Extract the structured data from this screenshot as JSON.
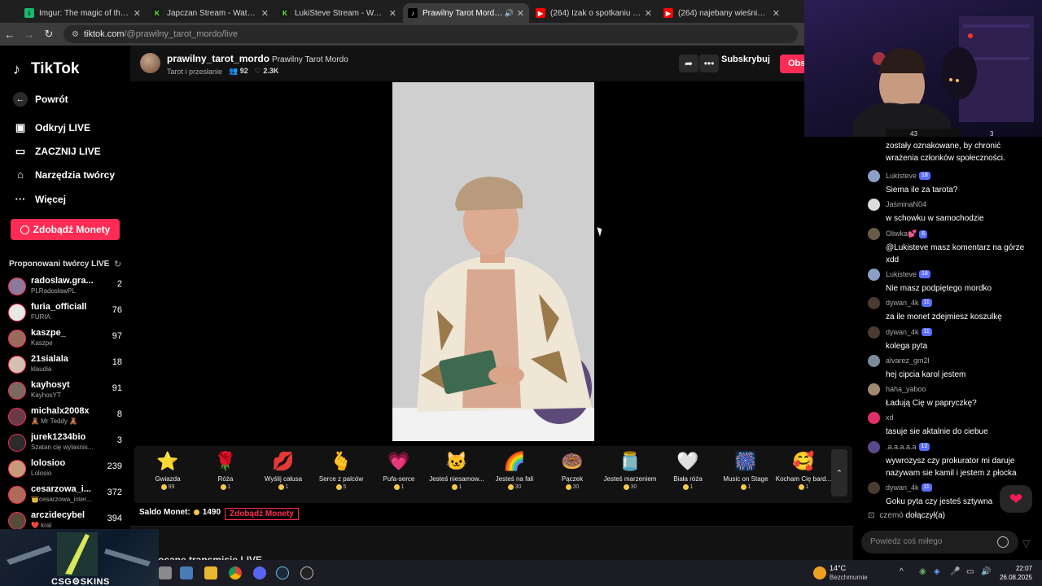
{
  "browser": {
    "tabs": [
      {
        "title": "Imgur: The magic of the Internet",
        "icon": "imgur-icon",
        "active": false
      },
      {
        "title": "Japczan Stream - Watch Live on Kick",
        "icon": "kick-icon",
        "active": false
      },
      {
        "title": "LukiSteve Stream - Watch Live on Kick",
        "icon": "kick-icon",
        "active": false
      },
      {
        "title": "Prawilny Tarot Mordo (@prawilny_tarot_mordo)",
        "icon": "tiktok-icon",
        "active": true
      },
      {
        "title": "(264) Izak o spotkaniu z Vysotzky",
        "icon": "youtube-icon",
        "active": false
      },
      {
        "title": "(264) najebany wieśniak - YouTube",
        "icon": "youtube-icon",
        "active": false
      }
    ],
    "url_host": "tiktok.com",
    "url_path": "/@prawilny_tarot_mordo/live"
  },
  "sidebar": {
    "logo": "TikTok",
    "back": "Powrót",
    "nav": [
      {
        "label": "Odkryj LIVE",
        "icon": "live-tv-icon"
      },
      {
        "label": "ZACZNIJ LIVE",
        "icon": "video-camera-icon"
      },
      {
        "label": "Narzędzia twórcy",
        "icon": "creator-tools-icon"
      },
      {
        "label": "Więcej",
        "icon": "more-dots-icon"
      }
    ],
    "coins_button": "Zdobądź Monety",
    "suggested_title": "Proponowani twórcy LIVE",
    "creators": [
      {
        "name": "radoslaw.gra...",
        "sub": "PLRadosławPL",
        "count": "2",
        "color": "#8a7a9c"
      },
      {
        "name": "furia_officiall",
        "sub": "FURIA",
        "count": "76",
        "color": "#e8e8e8"
      },
      {
        "name": "kaszpe_",
        "sub": "Kaszpe",
        "count": "97",
        "color": "#9a6b5a"
      },
      {
        "name": "21sialala",
        "sub": "klaudia",
        "count": "18",
        "color": "#d4c0b0"
      },
      {
        "name": "kayhosyt",
        "sub": "KayhosYT",
        "count": "91",
        "color": "#7a6a60"
      },
      {
        "name": "michalx2008x",
        "sub": "🧸 Mr Teddy 🧸",
        "count": "8",
        "color": "#6b3a4a"
      },
      {
        "name": "jurek1234bio",
        "sub": "Szatan cię wylasnis...",
        "count": "3",
        "color": "#2b2b2b"
      },
      {
        "name": "lolosioo",
        "sub": "Lolosio",
        "count": "239",
        "color": "#c89a7a"
      },
      {
        "name": "cesarzowa_i...",
        "sub": "👑cesarzowa_inter...",
        "count": "372",
        "color": "#b06a5a"
      },
      {
        "name": "arczidecybel",
        "sub": "❤️ kral",
        "count": "394",
        "color": "#5a4a3a"
      }
    ]
  },
  "stream": {
    "handle": "prawilny_tarot_mordo",
    "nickname": "Prawilny Tarot Mordo",
    "category": "Tarot i przesłanie",
    "viewers": "92",
    "likes": "2.3K",
    "subscribe": "Subskrybuj",
    "follow": "Obs"
  },
  "gifts": [
    {
      "name": "Gwiazda",
      "price": "99",
      "emoji": "⭐"
    },
    {
      "name": "Róża",
      "price": "1",
      "emoji": "🌹"
    },
    {
      "name": "Wyślij całusa",
      "price": "1",
      "emoji": "💋"
    },
    {
      "name": "Serce z palców",
      "price": "5",
      "emoji": "🫰"
    },
    {
      "name": "Pufa-serce",
      "price": "1",
      "emoji": "💗"
    },
    {
      "name": "Jesteś niesamow...",
      "price": "1",
      "emoji": "🐱"
    },
    {
      "name": "Jesteś na fali",
      "price": "30",
      "emoji": "🌈"
    },
    {
      "name": "Pączek",
      "price": "30",
      "emoji": "🍩"
    },
    {
      "name": "Jesteś marzeniem",
      "price": "30",
      "emoji": "🫙"
    },
    {
      "name": "Biała róża",
      "price": "1",
      "emoji": "🤍"
    },
    {
      "name": "Music on Stage",
      "price": "1",
      "emoji": "🎆"
    },
    {
      "name": "Kocham Cię bard...",
      "price": "1",
      "emoji": "🥰"
    }
  ],
  "balance": {
    "label": "Saldo Monet:",
    "value": "1490",
    "button": "Zdobądź Monety"
  },
  "bottom_title": "ocane transmisje LIVE",
  "webcam_counts": [
    "43",
    "3"
  ],
  "chat": {
    "messages": [
      {
        "name": "",
        "level": "",
        "text": "zostały oznakowane, by chronić wrażenia członków społeczności.",
        "color": ""
      },
      {
        "name": "Lukisteve",
        "level": "18",
        "text": "Siema ile za tarota?",
        "color": "#8aa0c8"
      },
      {
        "name": "JaśminaN04",
        "level": "",
        "text": "w schowku w samochodzie",
        "color": "#dddddd"
      },
      {
        "name": "Oliwka💕",
        "level": "6",
        "text": "@Lukisteve masz komentarz na górze xdd",
        "color": "#6a5a4a"
      },
      {
        "name": "Lukisteve",
        "level": "18",
        "text": "Nie masz podpiętego mordko",
        "color": "#8aa0c8"
      },
      {
        "name": "dywan_4k",
        "level": "11",
        "text": "za ile monet zdejmiesz koszulkę",
        "color": "#4a3a30"
      },
      {
        "name": "dywan_4k",
        "level": "11",
        "text": "kolega pyta",
        "color": "#4a3a30"
      },
      {
        "name": "alvarez_gm2l",
        "level": "",
        "text": "hej cipcia karol jestem",
        "color": "#7a8a9a"
      },
      {
        "name": "haha_yaboo",
        "level": "",
        "text": "Ładują Cię w papryczkę?",
        "color": "#a08a70"
      },
      {
        "name": "xd",
        "level": "",
        "text": "tasuje sie aktalnie do ciebue",
        "color": "#e0306a"
      },
      {
        "name": ".a.a.a.a.a",
        "level": "12",
        "text": "wywrozysz czy prokurator mi daruje nazywam sie kamil i jestem z płocka",
        "color": "#5a4a8a"
      },
      {
        "name": "dywan_4k",
        "level": "11",
        "text": "Goku pyta czy jesteś sztywna",
        "color": "#4a3a30"
      }
    ],
    "joined_name": "czemò",
    "joined_text": "dołączył(a)",
    "input_placeholder": "Powiedz coś miłego"
  },
  "overlay": {
    "brand": "CSG⚙SKINS"
  },
  "taskbar": {
    "temp": "14°C",
    "weather": "Bezchmurnie",
    "time": "22:07",
    "date": "26.08.2025"
  }
}
